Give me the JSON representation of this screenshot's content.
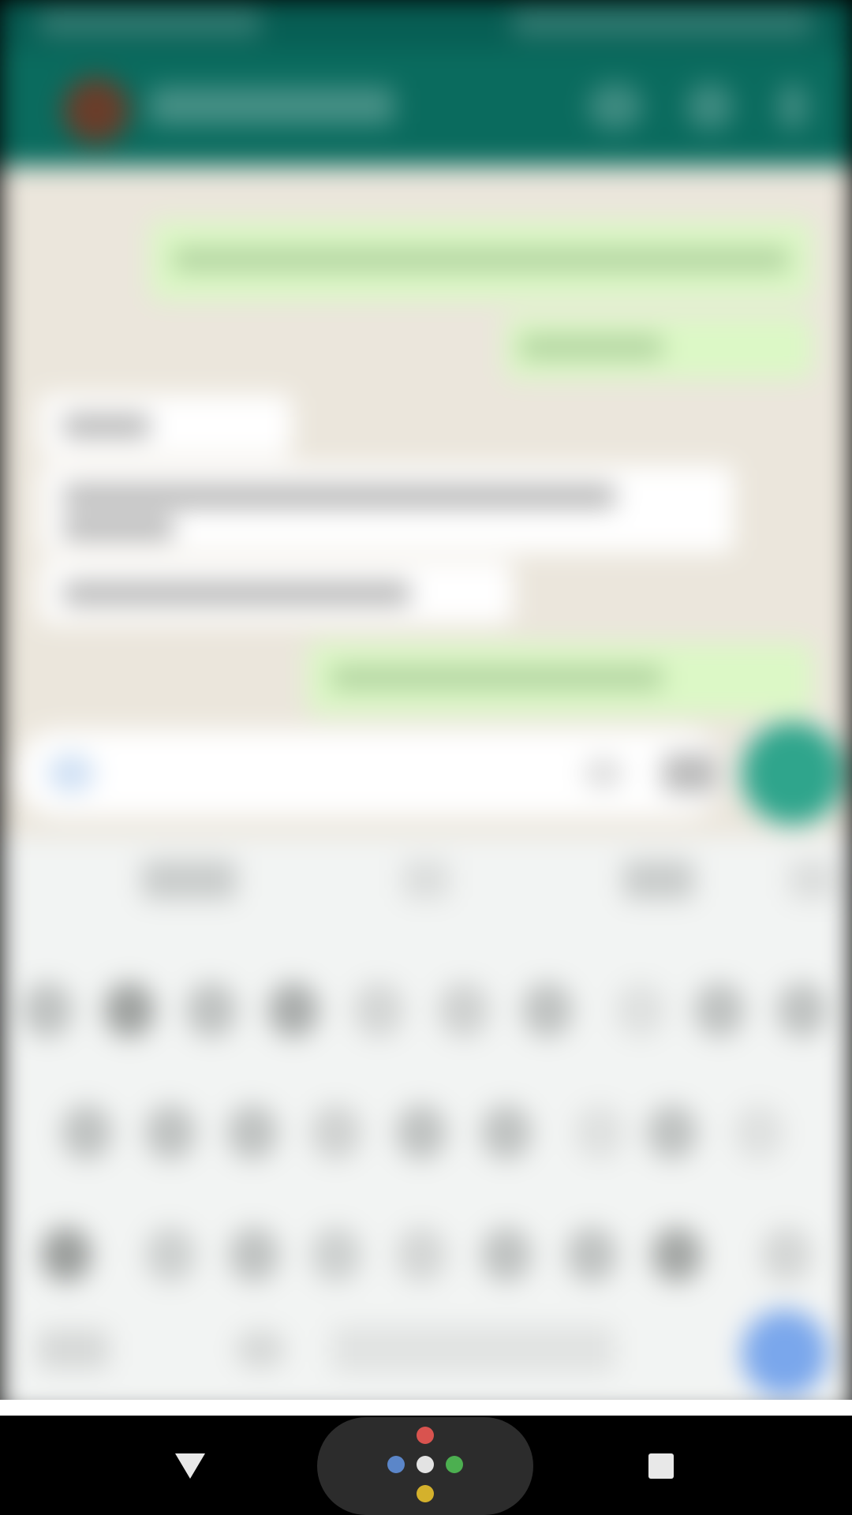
{
  "screen": {
    "state": "blurred behind assistant overlay"
  },
  "chat": {
    "header": {
      "contact_name": ""
    },
    "messages": [
      {
        "direction": "outgoing",
        "text": ""
      },
      {
        "direction": "outgoing",
        "text": ""
      },
      {
        "direction": "incoming",
        "text": ""
      },
      {
        "direction": "incoming",
        "text": ""
      },
      {
        "direction": "incoming",
        "text": ""
      },
      {
        "direction": "outgoing",
        "text": ""
      }
    ],
    "composer": {
      "placeholder": ""
    }
  },
  "colors": {
    "statusbar": "#075e54",
    "appbar": "#0a6b5e",
    "outgoing_bubble": "#dcf8c6",
    "incoming_bubble": "#ffffff",
    "mic_button": "#2fa58c",
    "assistant_dot_red": "#d9534f",
    "assistant_dot_blue": "#5b86c9",
    "assistant_dot_white": "#e3e3e3",
    "assistant_dot_green": "#4caf50",
    "assistant_dot_yellow": "#d4b12c"
  },
  "navbar": {
    "back_icon": "triangle-back-icon",
    "home_icon": "google-assistant-dots-icon",
    "recents_icon": "square-recents-icon"
  }
}
